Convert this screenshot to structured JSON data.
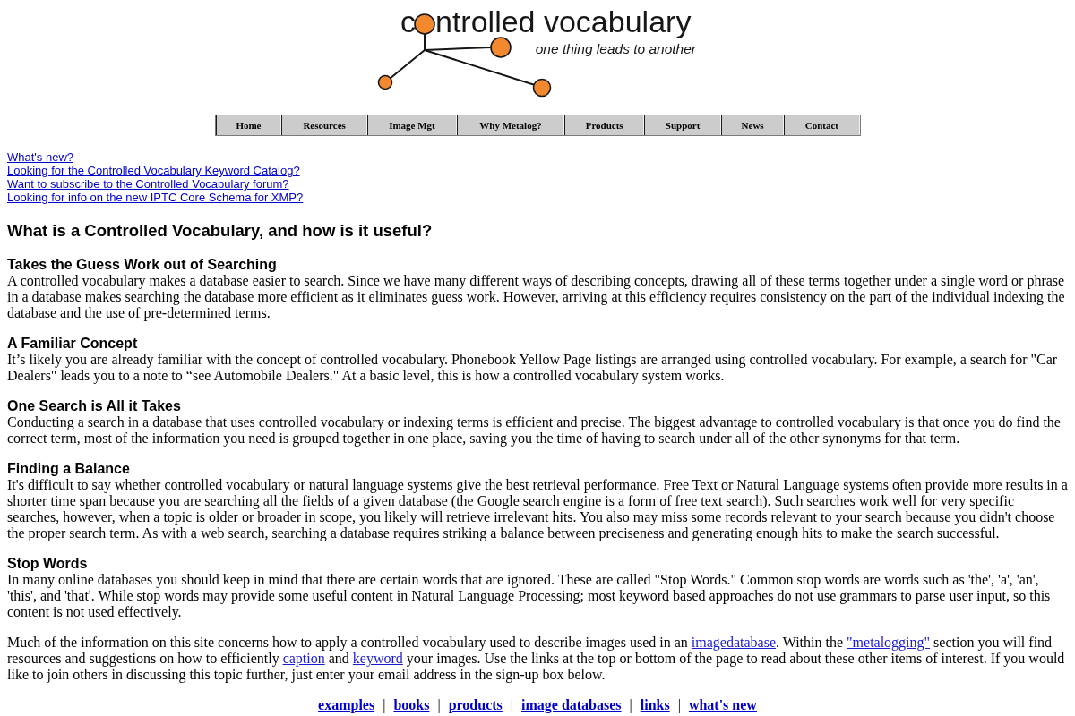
{
  "logo": {
    "wordmark_parts": [
      "c",
      "ntrolled vocabulary"
    ],
    "tagline": "one thing leads to another"
  },
  "nav": [
    {
      "label": "Home"
    },
    {
      "label": "Resources"
    },
    {
      "label": "Image Mgt"
    },
    {
      "label": "Why Metalog?"
    },
    {
      "label": "Products"
    },
    {
      "label": "Support"
    },
    {
      "label": "News"
    },
    {
      "label": "Contact"
    }
  ],
  "top_links": [
    "What's new?",
    "Looking for the Controlled Vocabulary Keyword Catalog?",
    "Want to subscribe to the Controlled Vocabulary forum?",
    "Looking for info on the new IPTC Core Schema for XMP?"
  ],
  "title": "What is a Controlled Vocabulary, and how is it useful?",
  "sections": [
    {
      "heading": "Takes the Guess Work out of Searching",
      "body": "A controlled vocabulary makes a database easier to search. Since we have many different ways of describing concepts, drawing all of these terms together under a single word or phrase in a database makes searching the database more efficient as it eliminates guess work. However, arriving at this efficiency requires consistency on the part of the individual indexing the database and the use of pre-determined terms."
    },
    {
      "heading": "A Familiar Concept",
      "body": "It’s likely you are already familiar with the concept of controlled vocabulary. Phonebook Yellow Page listings are arranged using controlled vocabulary. For example, a search for \"Car Dealers\" leads you to a note to “see Automobile Dealers.\" At a basic level, this is how a controlled vocabulary system works."
    },
    {
      "heading": "One Search is All it Takes",
      "body": "Conducting a search in a database that uses controlled vocabulary or indexing terms is efficient and precise. The biggest advantage to controlled vocabulary is that once you do find the correct term, most of the information you need is grouped together in one place, saving you the time of having to search under all of the other synonyms for that term."
    },
    {
      "heading": "Finding a Balance",
      "body": "It's difficult to say whether controlled vocabulary or natural language systems give the best retrieval performance. Free Text or Natural Language systems often provide more results in a shorter time span because you are searching all the fields of a given database (the Google search engine is a form of free text search). Such searches work well for very specific searches, however, when a topic is older or broader in scope, you likely will retrieve irrelevant hits. You also may miss some records relevant to your search because you didn't choose the proper search term. As with a web search, searching a database requires striking a balance between preciseness and generating enough hits to make the search successful."
    },
    {
      "heading": "Stop Words",
      "body": "In many online databases you should keep in mind that there are certain words that are ignored. These are called \"Stop Words.\" Common stop words are words such as 'the', 'a', 'an', 'this', and 'that'. While stop words may provide some useful content in Natural Language Processing; most keyword based approaches do not use grammars to parse user input, so this content is not used effectively."
    }
  ],
  "closing_paragraph": [
    {
      "kind": "text",
      "text": "Much of the information on this site concerns how to apply a controlled vocabulary used to describe images used in an "
    },
    {
      "kind": "link",
      "text": "imagedatabase"
    },
    {
      "kind": "text",
      "text": ". Within the "
    },
    {
      "kind": "link",
      "text": "\"metalogging\""
    },
    {
      "kind": "text",
      "text": " section you will find resources and suggestions on how to efficiently "
    },
    {
      "kind": "link",
      "text": "caption"
    },
    {
      "kind": "text",
      "text": " and "
    },
    {
      "kind": "link",
      "text": "keyword"
    },
    {
      "kind": "text",
      "text": " your images. Use the links at the top or bottom of the page to read about these other items of interest. If you would like to join others in discussing this topic further, just enter your email address in the sign-up box below."
    }
  ],
  "footer_links": [
    {
      "kind": "link",
      "text": "examples"
    },
    {
      "kind": "separator",
      "text": "|"
    },
    {
      "kind": "link",
      "text": "books"
    },
    {
      "kind": "separator",
      "text": "|"
    },
    {
      "kind": "link",
      "text": "products"
    },
    {
      "kind": "separator",
      "text": "|"
    },
    {
      "kind": "link",
      "text": "image databases"
    },
    {
      "kind": "separator",
      "text": "|"
    },
    {
      "kind": "link",
      "text": "links"
    },
    {
      "kind": "separator",
      "text": "|"
    },
    {
      "kind": "link",
      "text": "what's new"
    }
  ]
}
